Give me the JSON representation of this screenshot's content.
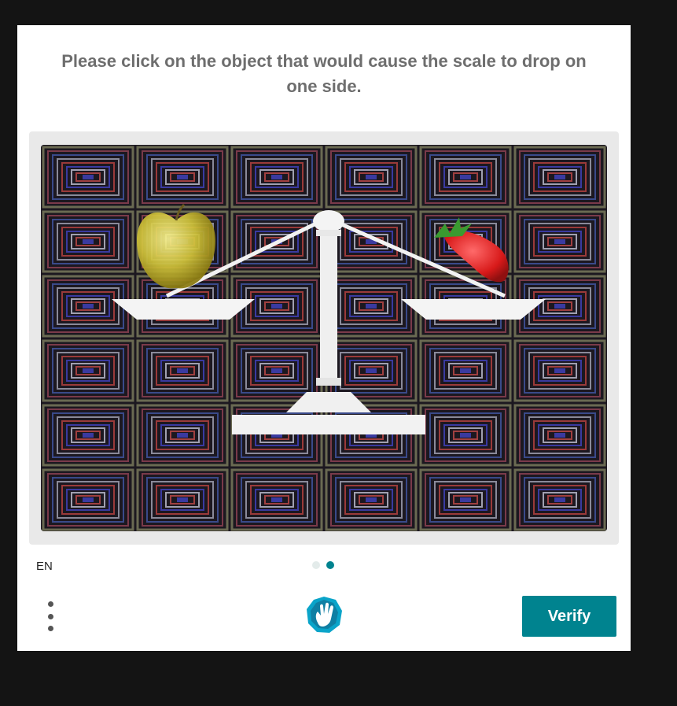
{
  "prompt": {
    "line1": "Please click on the object that would cause the scale to drop on",
    "line2": "one side."
  },
  "challenge": {
    "image": "balance-scale-with-apple-and-strawberry",
    "objects": [
      "apple",
      "strawberry"
    ],
    "page_count": 2,
    "current_page": 2
  },
  "footer": {
    "language": "EN",
    "menu_icon": "vertical-ellipsis-icon",
    "logo_icon": "hcaptcha-hand-logo",
    "verify_label": "Verify"
  },
  "colors": {
    "accent": "#00838f",
    "prompt_text": "#6e6e6e",
    "dot_inactive": "#e3ebea",
    "backdrop": "#141414"
  }
}
